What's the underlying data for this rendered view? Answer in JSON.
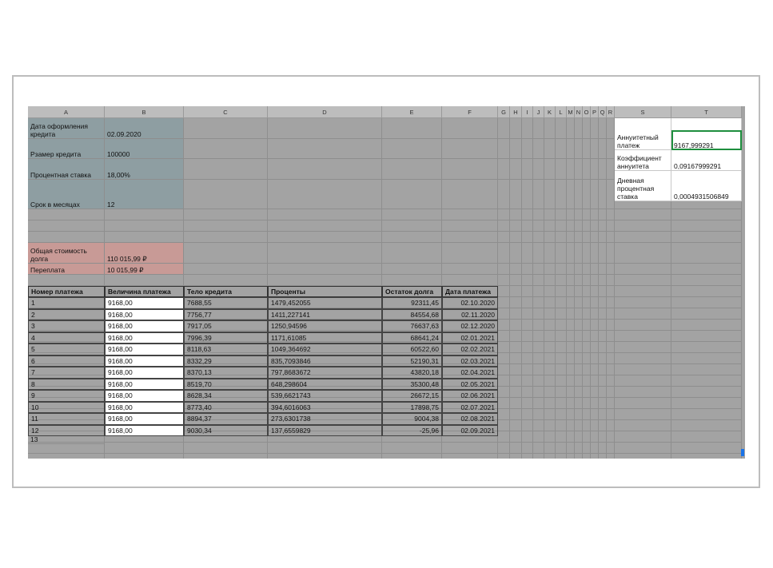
{
  "columns": [
    "A",
    "B",
    "C",
    "D",
    "E",
    "F",
    "G",
    "H",
    "I",
    "J",
    "K",
    "L",
    "M",
    "N",
    "O",
    "P",
    "Q",
    "R",
    "S",
    "T"
  ],
  "info": [
    {
      "label": "Дата оформления кредита",
      "value": "02.09.2020"
    },
    {
      "label": "Рзамер кредита",
      "value": "100000"
    },
    {
      "label": "Процентная ставка",
      "value": "18,00%"
    },
    {
      "label": "Срок в месяцах",
      "value": "12"
    }
  ],
  "totals": [
    {
      "label": "Общая стоимость долга",
      "value": "110 015,99 ₽"
    },
    {
      "label": "Переплата",
      "value": "10 015,99 ₽"
    }
  ],
  "calc": [
    {
      "label": "Аннуитетный платеж",
      "value": "9167,999291"
    },
    {
      "label": "Коэффициент аннуитета",
      "value": "0,09167999291"
    },
    {
      "label": "Дневная процентная ставка",
      "value": "0,0004931506849"
    }
  ],
  "table": {
    "headers": [
      "Номер платежа",
      "Величина платежа",
      "Тело кредита",
      "Проценты",
      "Остаток долга",
      "Дата платежа"
    ],
    "rows": [
      [
        "1",
        "9168,00",
        "7688,55",
        "1479,452055",
        "92311,45",
        "02.10.2020"
      ],
      [
        "2",
        "9168,00",
        "7756,77",
        "1411,227141",
        "84554,68",
        "02.11.2020"
      ],
      [
        "3",
        "9168,00",
        "7917,05",
        "1250,94596",
        "76637,63",
        "02.12.2020"
      ],
      [
        "4",
        "9168,00",
        "7996,39",
        "1171,61085",
        "68641,24",
        "02.01.2021"
      ],
      [
        "5",
        "9168,00",
        "8118,63",
        "1049,364692",
        "60522,60",
        "02.02.2021"
      ],
      [
        "6",
        "9168,00",
        "8332,29",
        "835,7093846",
        "52190,31",
        "02.03.2021"
      ],
      [
        "7",
        "9168,00",
        "8370,13",
        "797,8683672",
        "43820,18",
        "02.04.2021"
      ],
      [
        "8",
        "9168,00",
        "8519,70",
        "648,298604",
        "35300,48",
        "02.05.2021"
      ],
      [
        "9",
        "9168,00",
        "8628,34",
        "539,6621743",
        "26672,15",
        "02.06.2021"
      ],
      [
        "10",
        "9168,00",
        "8773,40",
        "394,6016063",
        "17898,75",
        "02.07.2021"
      ],
      [
        "11",
        "9168,00",
        "8894,37",
        "273,6301738",
        "9004,38",
        "02.08.2021"
      ],
      [
        "12",
        "9168,00",
        "9030,34",
        "137,6559829",
        "-25,96",
        "02.09.2021"
      ]
    ],
    "next_row": "13"
  }
}
